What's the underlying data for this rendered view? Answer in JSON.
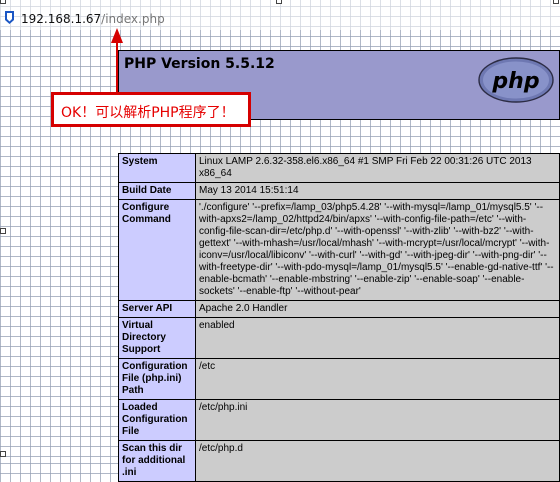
{
  "address_bar": {
    "host": "192.168.1.67",
    "path": "/index.php",
    "icon": "page-icon"
  },
  "php_header": {
    "title": "PHP Version 5.5.12",
    "logo_text": "php"
  },
  "annotation": {
    "text": "OK！可以解析PHP程序了！",
    "color": "#e60000"
  },
  "info_rows": [
    {
      "key": "System",
      "value": "Linux LAMP 2.6.32-358.el6.x86_64 #1 SMP Fri Feb 22 00:31:26 UTC 2013 x86_64"
    },
    {
      "key": "Build Date",
      "value": "May 13 2014 15:51:14"
    },
    {
      "key": "Configure Command",
      "value": "'./configure' '--prefix=/lamp_03/php5.4.28' '--with-mysql=/lamp_01/mysql5.5' '--with-apxs2=/lamp_02/httpd24/bin/apxs' '--with-config-file-path=/etc' '--with-config-file-scan-dir=/etc/php.d' '--with-openssl' '--with-zlib' '--with-bz2' '--with-gettext' '--with-mhash=/usr/local/mhash' '--with-mcrypt=/usr/local/mcrypt' '--with-iconv=/usr/local/libiconv' '--with-curl' '--with-gd' '--with-jpeg-dir' '--with-png-dir' '--with-freetype-dir' '--with-pdo-mysql=/lamp_01/mysql5.5' '--enable-gd-native-ttf' '--enable-bcmath' '--enable-mbstring' '--enable-zip' '--enable-soap' '--enable-sockets' '--enable-ftp' '--without-pear'"
    },
    {
      "key": "Server API",
      "value": "Apache 2.0 Handler"
    },
    {
      "key": "Virtual Directory Support",
      "value": "enabled"
    },
    {
      "key": "Configuration File (php.ini) Path",
      "value": "/etc"
    },
    {
      "key": "Loaded Configuration File",
      "value": "/etc/php.ini"
    },
    {
      "key": "Scan this dir for additional .ini",
      "value": "/etc/php.d"
    }
  ],
  "colors": {
    "header_bg": "#9999cc",
    "key_bg": "#ccccff",
    "value_bg": "#cccccc",
    "annotation_border": "#d50000"
  }
}
